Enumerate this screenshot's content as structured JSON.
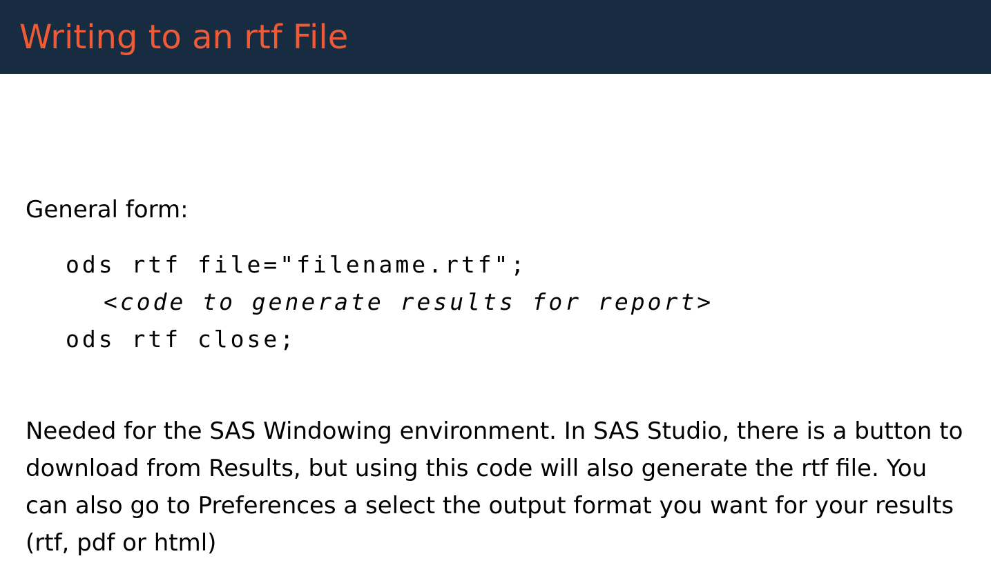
{
  "slide": {
    "title": "Writing to an rtf File"
  },
  "content": {
    "intro": "General form:",
    "code": {
      "line1": "ods rtf file=\"filename.rtf\";",
      "line2": "<code to generate results for report>",
      "line3": "ods rtf close;"
    },
    "paragraph": "Needed for the SAS Windowing environment. In SAS Studio, there is a button to download from Results, but using this code will also generate the rtf file. You can also go to Preferences a select the output format you want for your results (rtf, pdf or html)"
  },
  "colors": {
    "header_background": "#172b41",
    "title_text": "#ef5a37",
    "body_text": "#000000"
  }
}
